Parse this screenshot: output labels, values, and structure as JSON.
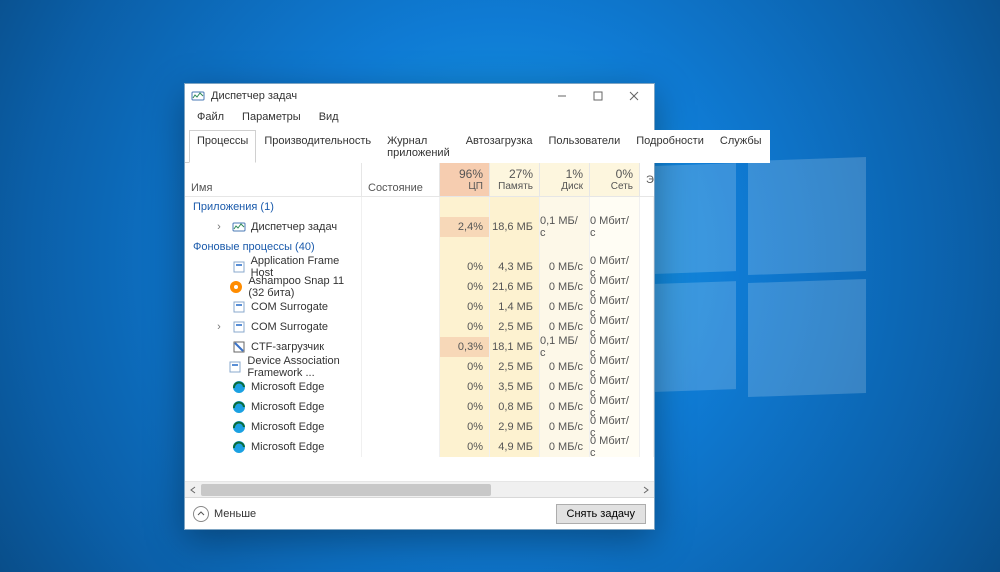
{
  "window": {
    "title": "Диспетчер задач",
    "menus": [
      "Файл",
      "Параметры",
      "Вид"
    ],
    "tabs": [
      "Процессы",
      "Производительность",
      "Журнал приложений",
      "Автозагрузка",
      "Пользователи",
      "Подробности",
      "Службы"
    ],
    "activeTab": 0
  },
  "columns": {
    "name": "Имя",
    "status": "Состояние",
    "cpu": {
      "pct": "96%",
      "label": "ЦП"
    },
    "mem": {
      "pct": "27%",
      "label": "Память"
    },
    "disk": {
      "pct": "1%",
      "label": "Диск"
    },
    "net": {
      "pct": "0%",
      "label": "Сеть"
    },
    "extra": "Э"
  },
  "groups": [
    {
      "title": "Приложения (1)"
    },
    {
      "title": "Фоновые процессы (40)"
    }
  ],
  "rows": [
    {
      "group": 0,
      "expand": true,
      "icon": "taskmgr",
      "name": "Диспетчер задач",
      "cpu": "2,4%",
      "mem": "18,6 МБ",
      "disk": "0,1 МБ/с",
      "net": "0 Мбит/с",
      "hot": true
    },
    {
      "group": 1,
      "expand": false,
      "icon": "app",
      "name": "Application Frame Host",
      "cpu": "0%",
      "mem": "4,3 МБ",
      "disk": "0 МБ/с",
      "net": "0 Мбит/с"
    },
    {
      "group": 1,
      "expand": false,
      "icon": "ashampoo",
      "name": "Ashampoo Snap 11 (32 бита)",
      "cpu": "0%",
      "mem": "21,6 МБ",
      "disk": "0 МБ/с",
      "net": "0 Мбит/с"
    },
    {
      "group": 1,
      "expand": false,
      "icon": "app",
      "name": "COM Surrogate",
      "cpu": "0%",
      "mem": "1,4 МБ",
      "disk": "0 МБ/с",
      "net": "0 Мбит/с"
    },
    {
      "group": 1,
      "expand": true,
      "icon": "app",
      "name": "COM Surrogate",
      "cpu": "0%",
      "mem": "2,5 МБ",
      "disk": "0 МБ/с",
      "net": "0 Мбит/с"
    },
    {
      "group": 1,
      "expand": false,
      "icon": "ctf",
      "name": "CTF-загрузчик",
      "cpu": "0,3%",
      "mem": "18,1 МБ",
      "disk": "0,1 МБ/с",
      "net": "0 Мбит/с",
      "hot": true
    },
    {
      "group": 1,
      "expand": false,
      "icon": "app",
      "name": "Device Association Framework ...",
      "cpu": "0%",
      "mem": "2,5 МБ",
      "disk": "0 МБ/с",
      "net": "0 Мбит/с"
    },
    {
      "group": 1,
      "expand": false,
      "icon": "edge",
      "name": "Microsoft Edge",
      "cpu": "0%",
      "mem": "3,5 МБ",
      "disk": "0 МБ/с",
      "net": "0 Мбит/с"
    },
    {
      "group": 1,
      "expand": false,
      "icon": "edge",
      "name": "Microsoft Edge",
      "cpu": "0%",
      "mem": "0,8 МБ",
      "disk": "0 МБ/с",
      "net": "0 Мбит/с"
    },
    {
      "group": 1,
      "expand": false,
      "icon": "edge",
      "name": "Microsoft Edge",
      "cpu": "0%",
      "mem": "2,9 МБ",
      "disk": "0 МБ/с",
      "net": "0 Мбит/с"
    },
    {
      "group": 1,
      "expand": false,
      "icon": "edge",
      "name": "Microsoft Edge",
      "cpu": "0%",
      "mem": "4,9 МБ",
      "disk": "0 МБ/с",
      "net": "0 Мбит/с"
    }
  ],
  "footer": {
    "less": "Меньше",
    "endTask": "Снять задачу"
  }
}
